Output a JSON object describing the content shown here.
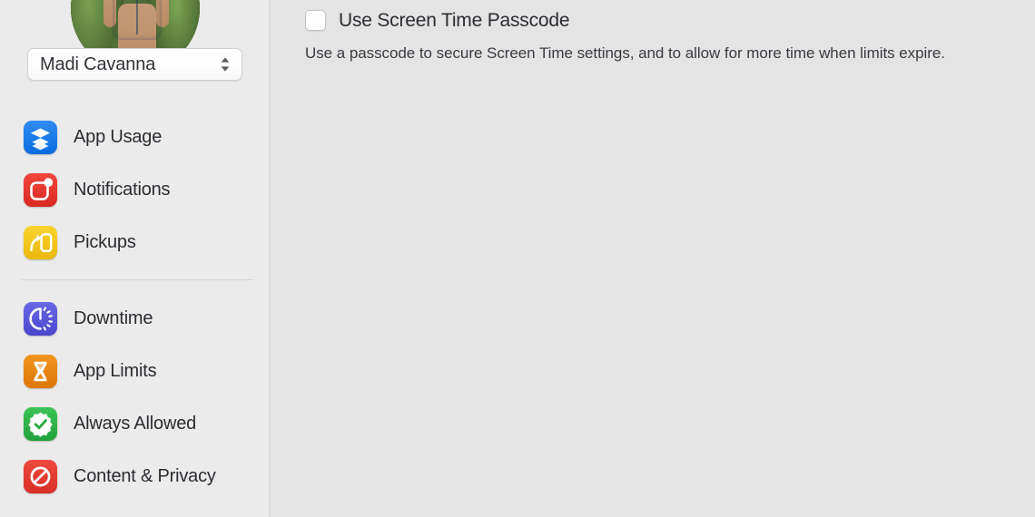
{
  "sidebar": {
    "avatar": {
      "icon": "user-avatar-photo",
      "alt": "Profile photo of child in denim overalls outdoors"
    },
    "user_popup": {
      "selected_user": "Madi Cavanna",
      "icon": "chevron-up-down-icon"
    },
    "groups": [
      {
        "items": [
          {
            "label": "App Usage",
            "icon": "app-usage-icon",
            "color": "#1579e8",
            "slug": "app-usage"
          },
          {
            "label": "Notifications",
            "icon": "notifications-icon",
            "color": "#e8352e",
            "slug": "notifications"
          },
          {
            "label": "Pickups",
            "icon": "pickups-icon",
            "color": "#f2c518",
            "slug": "pickups"
          }
        ]
      },
      {
        "items": [
          {
            "label": "Downtime",
            "icon": "downtime-icon",
            "color": "#5a57d8",
            "slug": "downtime"
          },
          {
            "label": "App Limits",
            "icon": "app-limits-icon",
            "color": "#e8881a",
            "slug": "app-limits"
          },
          {
            "label": "Always Allowed",
            "icon": "always-allowed-icon",
            "color": "#31b14a",
            "slug": "always-allowed"
          },
          {
            "label": "Content & Privacy",
            "icon": "content-privacy-icon",
            "color": "#e03c33",
            "slug": "content-privacy"
          }
        ]
      }
    ]
  },
  "main": {
    "passcode": {
      "checkbox_label": "Use Screen Time Passcode",
      "checked": false,
      "description": "Use a passcode to secure Screen Time settings, and to allow for more time when limits expire."
    }
  },
  "colors": {
    "sidebar_bg": "#ebebeb",
    "content_bg": "#e4e4e5",
    "separator": "#d4d4d4",
    "text_primary": "#2b2c31",
    "text_secondary": "#3a3b40"
  }
}
